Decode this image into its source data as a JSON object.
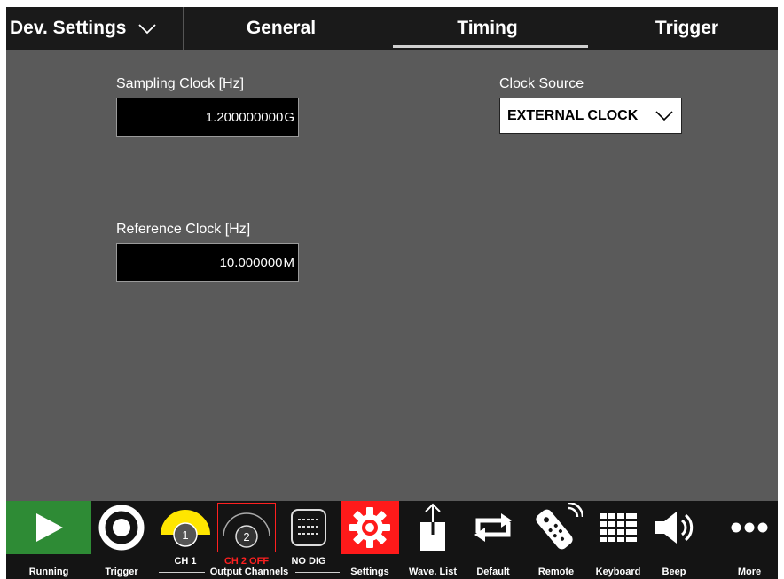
{
  "header": {
    "dev_settings": "Dev. Settings",
    "tabs": [
      {
        "label": "General"
      },
      {
        "label": "Timing"
      },
      {
        "label": "Trigger"
      }
    ],
    "active_tab": "Timing"
  },
  "timing": {
    "sampling_clock_label": "Sampling Clock [Hz]",
    "sampling_clock_value": "1.200000000",
    "sampling_clock_suffix": "G",
    "reference_clock_label": "Reference Clock [Hz]",
    "reference_clock_value": "10.000000",
    "reference_clock_suffix": "M",
    "clock_source_label": "Clock Source",
    "clock_source_value": "EXTERNAL CLOCK"
  },
  "toolbar": {
    "running": "Running",
    "trigger": "Trigger",
    "ch1_num": "1",
    "ch1_label": "CH 1",
    "ch2_num": "2",
    "ch2_label": "CH 2 OFF",
    "nodig_label": "NO DIG",
    "output_channels": "Output Channels",
    "settings": "Settings",
    "wave_list": "Wave. List",
    "default": "Default",
    "remote": "Remote",
    "keyboard": "Keyboard",
    "beep": "Beep",
    "more": "More"
  },
  "colors": {
    "running_green": "#2e8b35",
    "settings_red": "#ff1a1a",
    "ch1_yellow": "#ffe600",
    "ch2_red": "#ff2020"
  },
  "icons": [
    "play-icon",
    "trigger-icon",
    "channel-dial-icon",
    "digital-icon",
    "gear-icon",
    "upload-icon",
    "repeat-icon",
    "remote-icon",
    "keyboard-icon",
    "speaker-icon",
    "more-icon",
    "chevron-down-icon"
  ]
}
